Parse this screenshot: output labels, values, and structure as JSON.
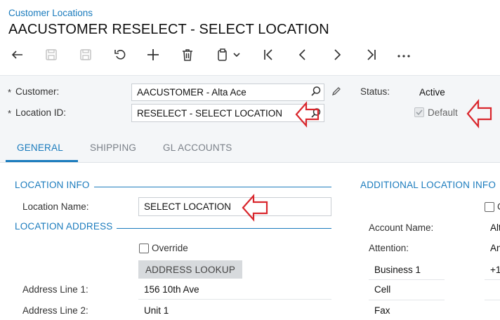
{
  "breadcrumb": "Customer Locations",
  "title": "AACUSTOMER RESELECT - SELECT LOCATION",
  "toolbar": {
    "icons": [
      "undo-arrow-icon",
      "save-close-icon",
      "save-icon",
      "cancel-icon",
      "add-icon",
      "delete-icon",
      "copy-paste-icon",
      "chevron-down-icon",
      "first-record-icon",
      "previous-record-icon",
      "next-record-icon",
      "last-record-icon",
      "more-icon"
    ]
  },
  "header": {
    "customer_label": "Customer:",
    "customer_value": "AACUSTOMER - Alta Ace",
    "location_id_label": "Location ID:",
    "location_id_value": "RESELECT - SELECT LOCATION",
    "required_mark": "*",
    "status_label": "Status:",
    "status_value": "Active",
    "default_label": "Default",
    "default_checked": true
  },
  "tabs": [
    {
      "label": "GENERAL",
      "active": true
    },
    {
      "label": "SHIPPING",
      "active": false
    },
    {
      "label": "GL ACCOUNTS",
      "active": false
    }
  ],
  "location_info": {
    "section_title": "LOCATION INFO",
    "location_name_label": "Location Name:",
    "location_name_value": "SELECT LOCATION"
  },
  "location_address": {
    "section_title": "LOCATION ADDRESS",
    "override_label": "Override",
    "address_lookup_label": "ADDRESS LOOKUP",
    "address_line1_label": "Address Line 1:",
    "address_line1_value": "156 10th Ave",
    "address_line2_label": "Address Line 2:",
    "address_line2_value": "Unit 1"
  },
  "additional_info": {
    "section_title": "ADDITIONAL LOCATION INFO",
    "checkbox_label_clipped": "C",
    "account_name_label": "Account Name:",
    "account_name_value_clipped": "Alt",
    "attention_label": "Attention:",
    "attention_value_clipped": "An",
    "phone_rows": [
      {
        "type": "Business 1",
        "value_clipped": "+1"
      },
      {
        "type": "Cell",
        "value_clipped": ""
      },
      {
        "type": "Fax",
        "value_clipped": ""
      }
    ]
  },
  "annotation_color": "#d9262c",
  "accent_color": "#1a7bbd"
}
